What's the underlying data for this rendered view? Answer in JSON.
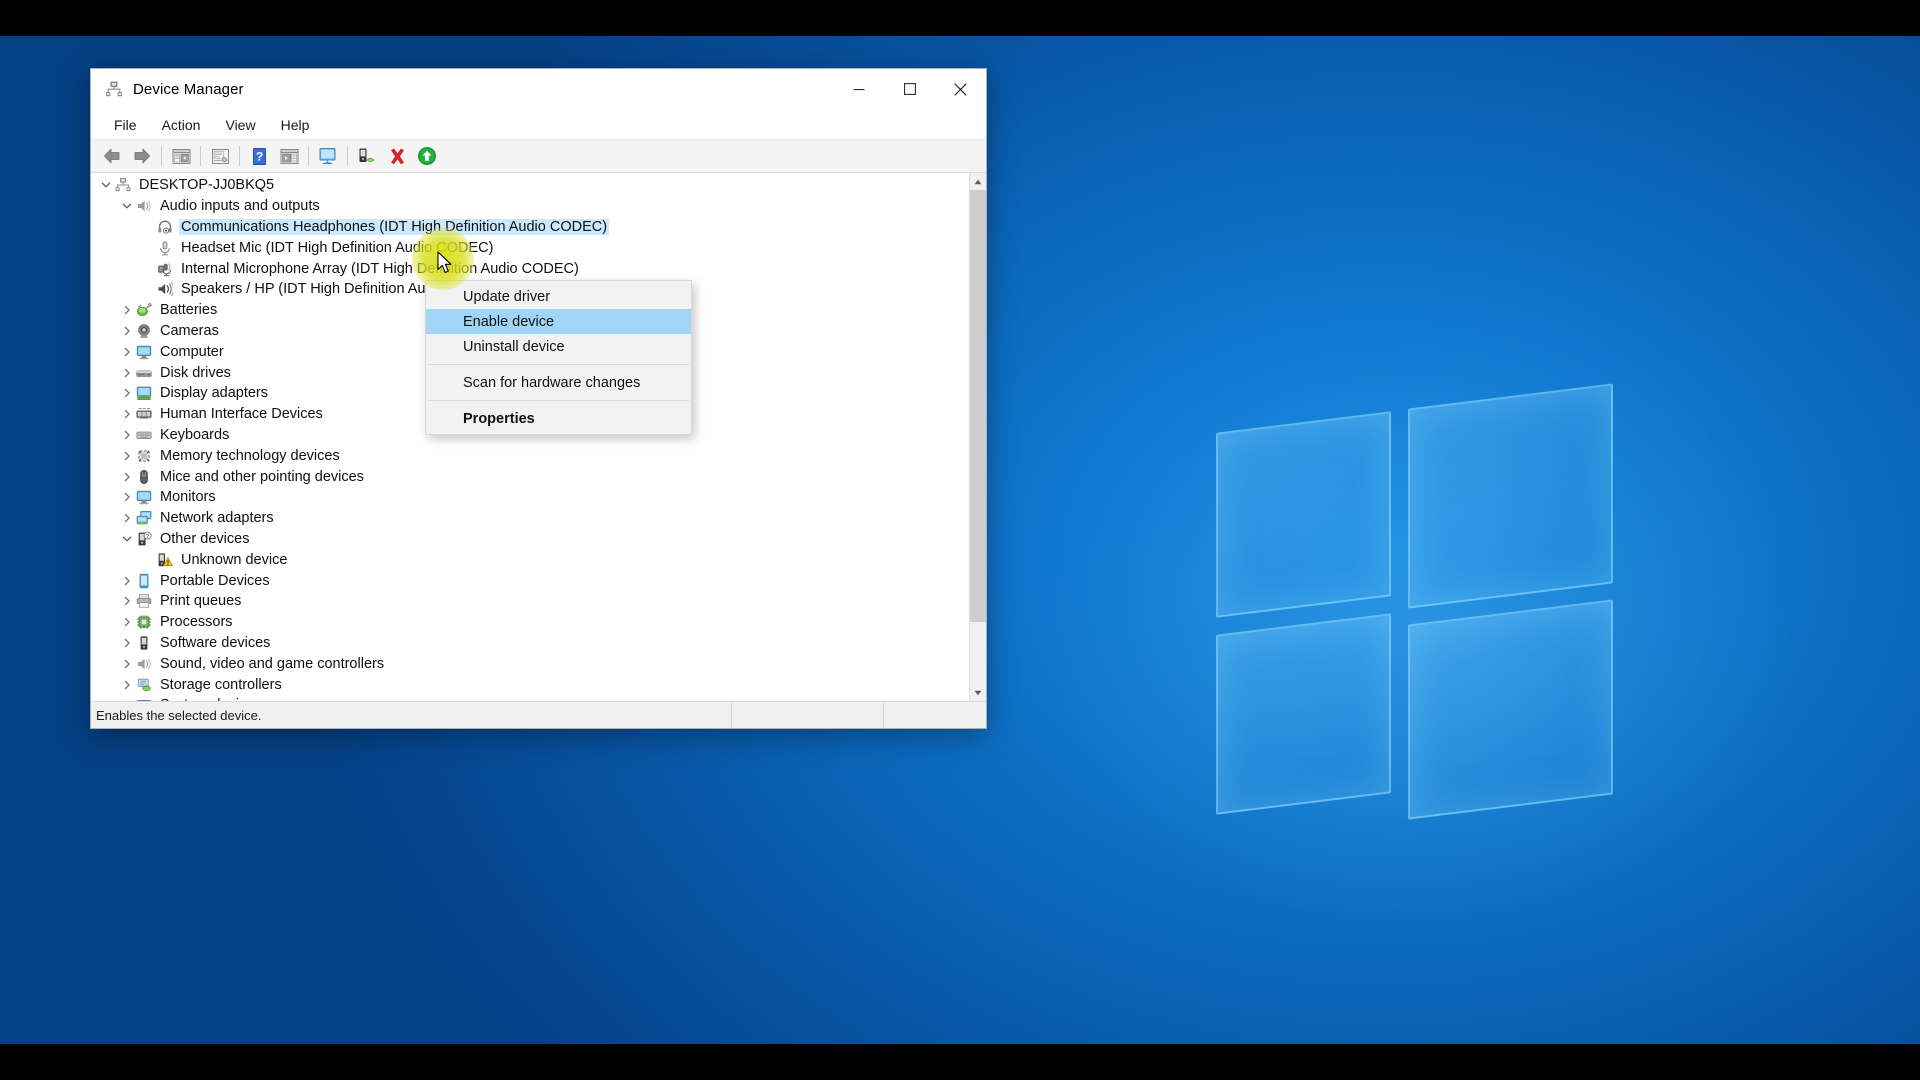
{
  "window": {
    "title": "Device Manager",
    "title_icon": "device-manager-icon",
    "controls": {
      "minimize": "—",
      "maximize": "□",
      "close": "✕"
    }
  },
  "menubar": {
    "items": [
      "File",
      "Action",
      "View",
      "Help"
    ]
  },
  "toolbar": {
    "buttons": [
      {
        "name": "back-icon"
      },
      {
        "name": "forward-icon"
      },
      {
        "name": "show-hide-console-tree-icon"
      },
      {
        "name": "properties-icon"
      },
      {
        "name": "help-icon"
      },
      {
        "name": "show-hide-action-pane-icon"
      },
      {
        "name": "scan-for-hardware-changes-icon"
      },
      {
        "name": "update-driver-icon"
      },
      {
        "name": "uninstall-device-icon"
      },
      {
        "name": "enable-device-icon"
      }
    ]
  },
  "tree": {
    "nodes": [
      {
        "label": "DESKTOP-JJ0BKQ5",
        "depth": 0,
        "twisty": "expanded",
        "icon": "computer-root-icon",
        "selected": false
      },
      {
        "label": "Audio inputs and outputs",
        "depth": 1,
        "twisty": "expanded",
        "icon": "speaker-icon",
        "selected": false
      },
      {
        "label": "Communications Headphones (IDT High Definition Audio CODEC)",
        "depth": 2,
        "twisty": "none",
        "icon": "headphones-icon",
        "selected": true
      },
      {
        "label": "Headset Mic (IDT High Definition Audio CODEC)",
        "depth": 2,
        "twisty": "none",
        "icon": "microphone-icon",
        "selected": false
      },
      {
        "label": "Internal Microphone Array (IDT High Definition Audio CODEC)",
        "depth": 2,
        "twisty": "none",
        "icon": "microphone-array-icon",
        "selected": false
      },
      {
        "label": "Speakers / HP (IDT High Definition Audio CODEC)",
        "depth": 2,
        "twisty": "none",
        "icon": "speakers-icon",
        "selected": false
      },
      {
        "label": "Batteries",
        "depth": 1,
        "twisty": "collapsed",
        "icon": "battery-icon",
        "selected": false
      },
      {
        "label": "Cameras",
        "depth": 1,
        "twisty": "collapsed",
        "icon": "camera-icon",
        "selected": false
      },
      {
        "label": "Computer",
        "depth": 1,
        "twisty": "collapsed",
        "icon": "computer-icon",
        "selected": false
      },
      {
        "label": "Disk drives",
        "depth": 1,
        "twisty": "collapsed",
        "icon": "disk-drive-icon",
        "selected": false
      },
      {
        "label": "Display adapters",
        "depth": 1,
        "twisty": "collapsed",
        "icon": "display-adapter-icon",
        "selected": false
      },
      {
        "label": "Human Interface Devices",
        "depth": 1,
        "twisty": "collapsed",
        "icon": "hid-icon",
        "selected": false
      },
      {
        "label": "Keyboards",
        "depth": 1,
        "twisty": "collapsed",
        "icon": "keyboard-icon",
        "selected": false
      },
      {
        "label": "Memory technology devices",
        "depth": 1,
        "twisty": "collapsed",
        "icon": "memory-technology-icon",
        "selected": false
      },
      {
        "label": "Mice and other pointing devices",
        "depth": 1,
        "twisty": "collapsed",
        "icon": "mouse-icon",
        "selected": false
      },
      {
        "label": "Monitors",
        "depth": 1,
        "twisty": "collapsed",
        "icon": "monitor-icon",
        "selected": false
      },
      {
        "label": "Network adapters",
        "depth": 1,
        "twisty": "collapsed",
        "icon": "network-adapter-icon",
        "selected": false
      },
      {
        "label": "Other devices",
        "depth": 1,
        "twisty": "expanded",
        "icon": "other-devices-icon",
        "selected": false
      },
      {
        "label": "Unknown device",
        "depth": 2,
        "twisty": "none",
        "icon": "unknown-device-warning-icon",
        "selected": false
      },
      {
        "label": "Portable Devices",
        "depth": 1,
        "twisty": "collapsed",
        "icon": "portable-device-icon",
        "selected": false
      },
      {
        "label": "Print queues",
        "depth": 1,
        "twisty": "collapsed",
        "icon": "printer-icon",
        "selected": false
      },
      {
        "label": "Processors",
        "depth": 1,
        "twisty": "collapsed",
        "icon": "processor-icon",
        "selected": false
      },
      {
        "label": "Software devices",
        "depth": 1,
        "twisty": "collapsed",
        "icon": "software-device-icon",
        "selected": false
      },
      {
        "label": "Sound, video and game controllers",
        "depth": 1,
        "twisty": "collapsed",
        "icon": "sound-video-icon",
        "selected": false
      },
      {
        "label": "Storage controllers",
        "depth": 1,
        "twisty": "collapsed",
        "icon": "storage-controller-icon",
        "selected": false
      },
      {
        "label": "System devices",
        "depth": 1,
        "twisty": "collapsed",
        "icon": "system-device-icon",
        "selected": false
      }
    ]
  },
  "context_menu": {
    "items": [
      {
        "label": "Update driver",
        "state": "normal"
      },
      {
        "label": "Enable device",
        "state": "highlighted"
      },
      {
        "label": "Uninstall device",
        "state": "normal"
      },
      {
        "separator_after": true
      },
      {
        "label": "Scan for hardware changes",
        "state": "normal"
      },
      {
        "separator_after": true
      },
      {
        "label": "Properties",
        "state": "bold"
      }
    ]
  },
  "statusbar": {
    "text": "Enables the selected device."
  },
  "colors": {
    "selection_blue": "#cce8ff",
    "menu_highlight": "#9fd5f7",
    "cursor_halo_yellow": "#d2e100",
    "uninstall_red": "#d42626",
    "enable_green": "#1f9e32",
    "desktop_blue": "#0f79d0"
  }
}
